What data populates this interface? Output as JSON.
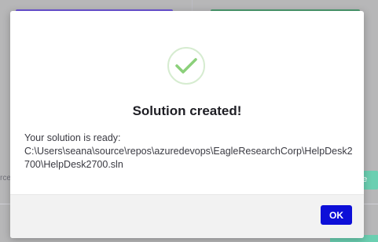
{
  "background": {
    "left_text": "rce",
    "right_button_label": "ate"
  },
  "dialog": {
    "icon": "check-circle-icon",
    "title": "Solution created!",
    "message_line1": "Your solution is ready:",
    "message_path": "C:\\Users\\seana\\source\\repos\\azuredevops\\EagleResearchCorp\\HelpDesk2700\\HelpDesk2700.sln",
    "ok_label": "OK"
  },
  "colors": {
    "ok_button": "#0d0fd8",
    "check": "#8bd07a",
    "check_ring": "#d6ecd0"
  }
}
